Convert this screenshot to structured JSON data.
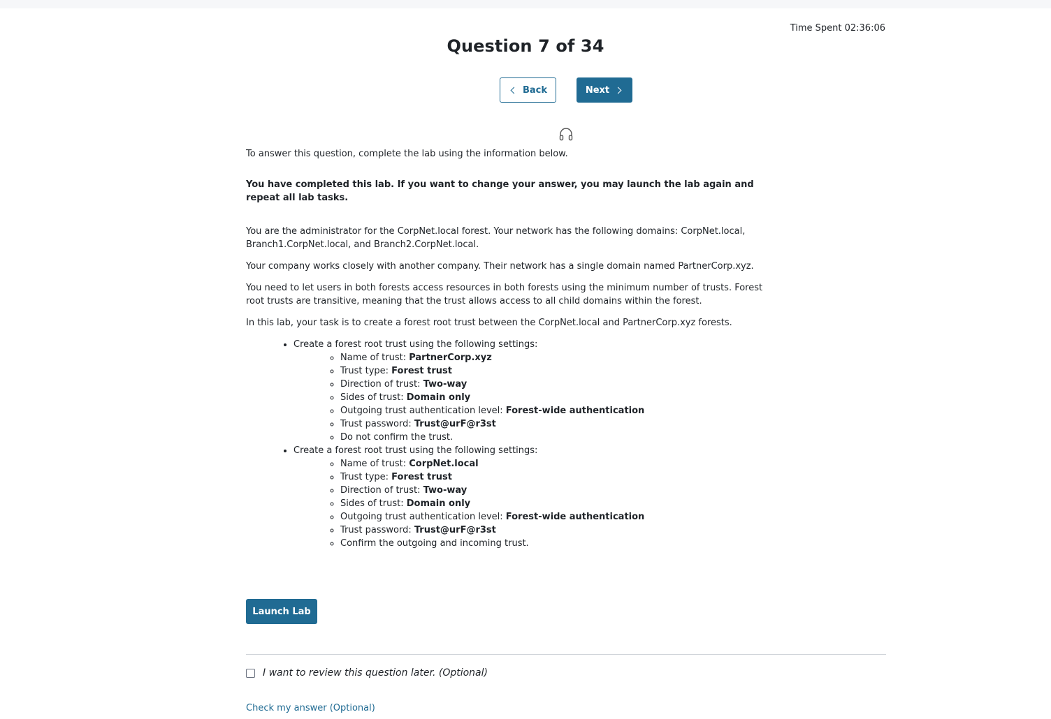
{
  "timer": {
    "label": "Time Spent 02:36:06"
  },
  "question": {
    "title": "Question 7 of 34"
  },
  "nav": {
    "back_label": "Back",
    "next_label": "Next"
  },
  "instructions": {
    "intro": "To answer this question, complete the lab using the information below.",
    "completed": "You have completed this lab. If you want to change your answer, you may launch the lab again and repeat all lab tasks.",
    "p1": "You are the administrator for the CorpNet.local forest. Your network has the following domains: CorpNet.local, Branch1.CorpNet.local, and Branch2.CorpNet.local.",
    "p2": "Your company works closely with another company. Their network has a single domain named PartnerCorp.xyz.",
    "p3": "You need to let users in both forests access resources in both forests using the minimum number of trusts. Forest root trusts are transitive, meaning that the trust allows access to all child domains within the forest.",
    "p4": "In this lab, your task is to create a forest root trust between the CorpNet.local and PartnerCorp.xyz forests.",
    "tasks": [
      {
        "label": "Create a forest root trust using the following settings:",
        "settings": [
          {
            "name": "Name of trust: ",
            "value": "PartnerCorp.xyz"
          },
          {
            "name": "Trust type: ",
            "value": "Forest trust"
          },
          {
            "name": "Direction of trust: ",
            "value": "Two-way"
          },
          {
            "name": "Sides of trust: ",
            "value": "Domain only"
          },
          {
            "name": "Outgoing trust authentication level: ",
            "value": "Forest-wide authentication"
          },
          {
            "name": "Trust password: ",
            "value": "Trust@urF@r3st"
          },
          {
            "name": "Do not confirm the trust.",
            "value": ""
          }
        ]
      },
      {
        "label": "Create a forest root trust using the following settings:",
        "settings": [
          {
            "name": "Name of trust: ",
            "value": "CorpNet.local"
          },
          {
            "name": "Trust type: ",
            "value": "Forest trust"
          },
          {
            "name": "Direction of trust: ",
            "value": "Two-way"
          },
          {
            "name": "Sides of trust: ",
            "value": "Domain only"
          },
          {
            "name": "Outgoing trust authentication level: ",
            "value": "Forest-wide authentication"
          },
          {
            "name": "Trust password: ",
            "value": "Trust@urF@r3st"
          },
          {
            "name": "Confirm the outgoing and incoming trust.",
            "value": ""
          }
        ]
      }
    ]
  },
  "actions": {
    "launch_label": "Launch Lab",
    "review_label": "I want to review this question later. (Optional)",
    "check_label": "Check my answer (Optional)"
  },
  "icons": {
    "audio": "headphones-icon",
    "back": "chevron-left-icon",
    "next": "chevron-right-icon"
  },
  "colors": {
    "accent": "#206b93",
    "text": "#1f2328",
    "divider": "#d0d4d9"
  }
}
